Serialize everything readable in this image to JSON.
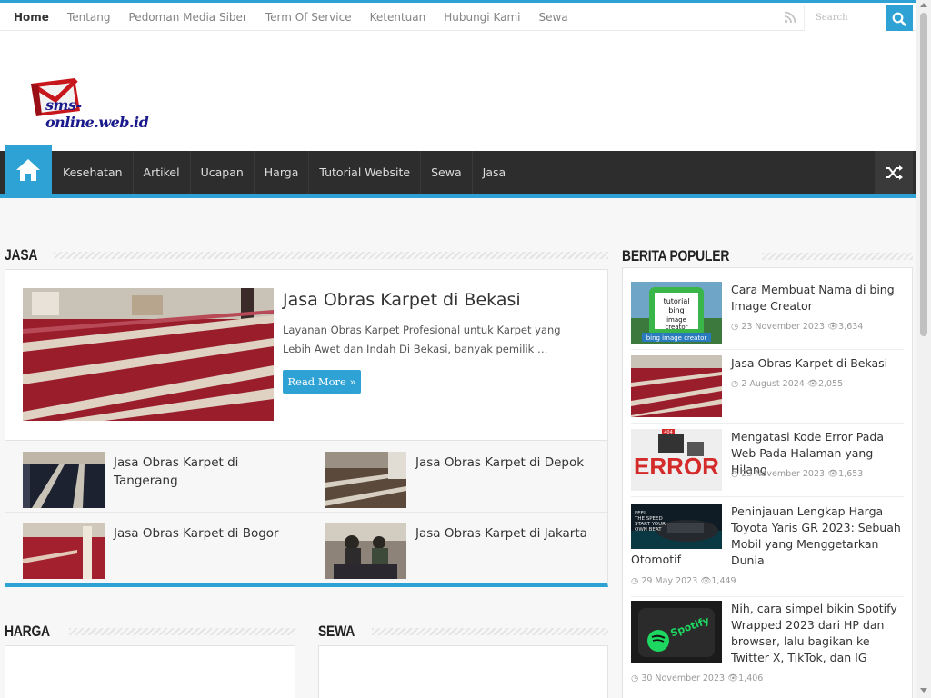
{
  "top_menu": [
    "Home",
    "Tentang",
    "Pedoman Media Siber",
    "Term Of Service",
    "Ketentuan",
    "Hubungi Kami",
    "Sewa"
  ],
  "search": {
    "placeholder": "Search"
  },
  "logo": {
    "text": "sms-online.web.id"
  },
  "main_menu": [
    "Kesehatan",
    "Artikel",
    "Ucapan",
    "Harga",
    "Tutorial Website",
    "Sewa",
    "Jasa"
  ],
  "jasa": {
    "title": "Jasa",
    "featured": {
      "title": "Jasa Obras Karpet di Bekasi",
      "excerpt": "Layanan Obras Karpet Profesional untuk Karpet yang Lebih Awet dan Indah Di Bekasi, banyak pemilik …",
      "read_more": "Read More »"
    },
    "items": [
      {
        "title": "Jasa Obras Karpet di Tangerang"
      },
      {
        "title": "Jasa Obras Karpet di Depok"
      },
      {
        "title": "Jasa Obras Karpet di Bogor"
      },
      {
        "title": "Jasa Obras Karpet di Jakarta"
      }
    ]
  },
  "harga": {
    "title": "Harga"
  },
  "sewa": {
    "title": "Sewa"
  },
  "popular": {
    "title": "Berita Populer",
    "items": [
      {
        "title": "Cara Membuat Nama di bing Image Creator",
        "date": "23 November 2023",
        "views": "3,634"
      },
      {
        "title": "Jasa Obras Karpet di Bekasi",
        "date": "2 August 2024",
        "views": "2,055"
      },
      {
        "title": "Mengatasi Kode Error Pada Web Pada Halaman yang Hilang",
        "date": "23 November 2023",
        "views": "1,653"
      },
      {
        "title": "Peninjauan Lengkap Harga Toyota Yaris GR 2023: Sebuah Mobil yang Menggetarkan Dunia",
        "title_end": "Otomotif",
        "date": "29 May 2023",
        "views": "1,449"
      },
      {
        "title": "Nih, cara simpel bikin Spotify Wrapped 2023 dari HP dan browser, lalu bagikan ke Twitter X, TikTok, dan IG",
        "date": "30 November 2023",
        "views": "1,406"
      }
    ]
  },
  "thumb_texts": {
    "bing": "tutorial bing image creator",
    "error": "ERROR",
    "error_tag": "404",
    "yaris": "FEEL THE SPEED START YOUR OWN BEAT",
    "spotify": "Spotify"
  },
  "colors": {
    "accent": "#2ea2d4",
    "nav_dark": "#2d2d2d"
  }
}
